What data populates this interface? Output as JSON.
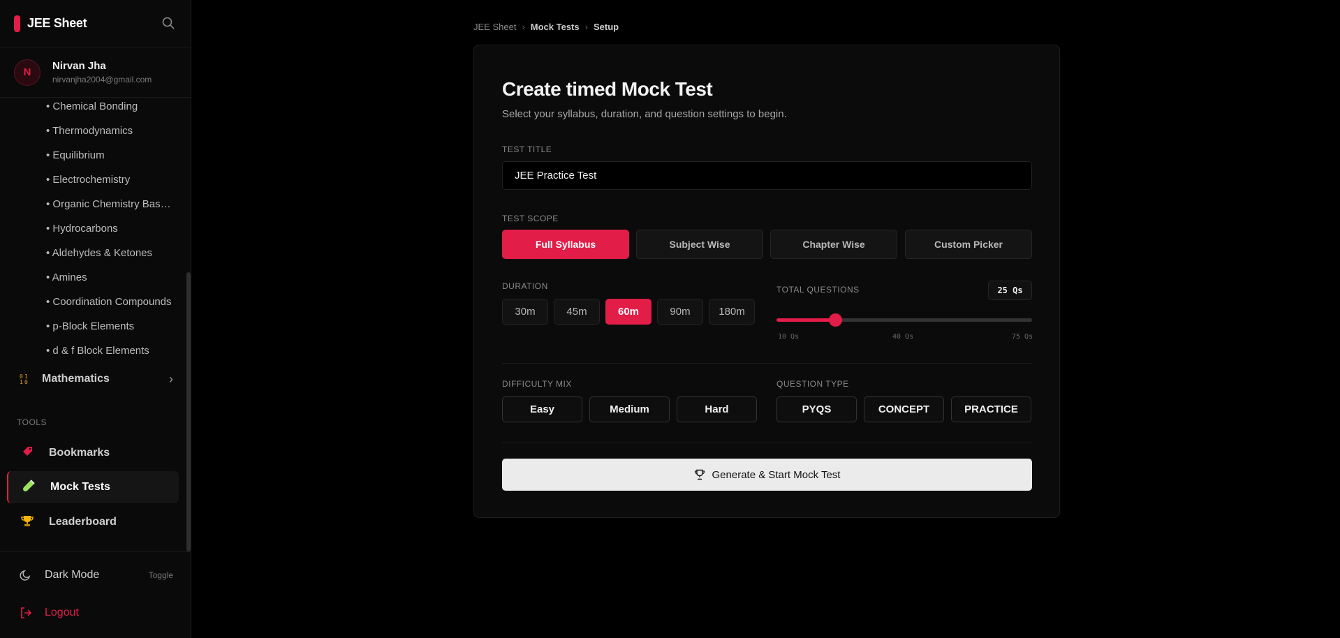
{
  "brand": {
    "title": "JEE Sheet",
    "accent": "#e11d48"
  },
  "user": {
    "initial": "N",
    "name": "Nirvan Jha",
    "email": "nirvanjha2004@gmail.com"
  },
  "chapters": [
    "• Chemical Bonding",
    "• Thermodynamics",
    "• Equilibrium",
    "• Electrochemistry",
    "• Organic Chemistry Basics",
    "• Hydrocarbons",
    "• Aldehydes & Ketones",
    "• Amines",
    "• Coordination Compounds",
    "• p-Block Elements",
    "• d & f Block Elements"
  ],
  "subject": {
    "label": "Mathematics",
    "icon": "math-grid-icon"
  },
  "tools": {
    "heading": "TOOLS",
    "items": [
      {
        "label": "Bookmarks",
        "icon": "bookmark-icon"
      },
      {
        "label": "Mock Tests",
        "icon": "test-tube-icon",
        "active": true
      },
      {
        "label": "Leaderboard",
        "icon": "trophy-icon"
      }
    ]
  },
  "bottom": {
    "dark_mode": "Dark Mode",
    "toggle": "Toggle",
    "logout": "Logout"
  },
  "breadcrumb": [
    "JEE Sheet",
    "Mock Tests",
    "Setup"
  ],
  "form": {
    "title": "Create timed Mock Test",
    "subtitle": "Select your syllabus, duration, and question settings to begin.",
    "test_title_label": "TEST TITLE",
    "test_title_value": "JEE Practice Test",
    "scope_label": "TEST SCOPE",
    "scope_options": [
      "Full Syllabus",
      "Subject Wise",
      "Chapter Wise",
      "Custom Picker"
    ],
    "scope_selected": "Full Syllabus",
    "duration_label": "DURATION",
    "durations": [
      "30m",
      "45m",
      "60m",
      "90m",
      "180m"
    ],
    "duration_selected": "60m",
    "total_questions_label": "TOTAL QUESTIONS",
    "total_questions_badge": "25 Qs",
    "slider": {
      "min": 10,
      "max": 75,
      "value": 25,
      "ticks": [
        "10 Qs",
        "40 Qs",
        "75 Qs"
      ]
    },
    "difficulty_label": "DIFFICULTY MIX",
    "difficulty": [
      "Easy",
      "Medium",
      "Hard"
    ],
    "question_type_label": "QUESTION TYPE",
    "question_types": [
      "PYQS",
      "CONCEPT",
      "PRACTICE"
    ],
    "cta": "Generate & Start Mock Test"
  }
}
